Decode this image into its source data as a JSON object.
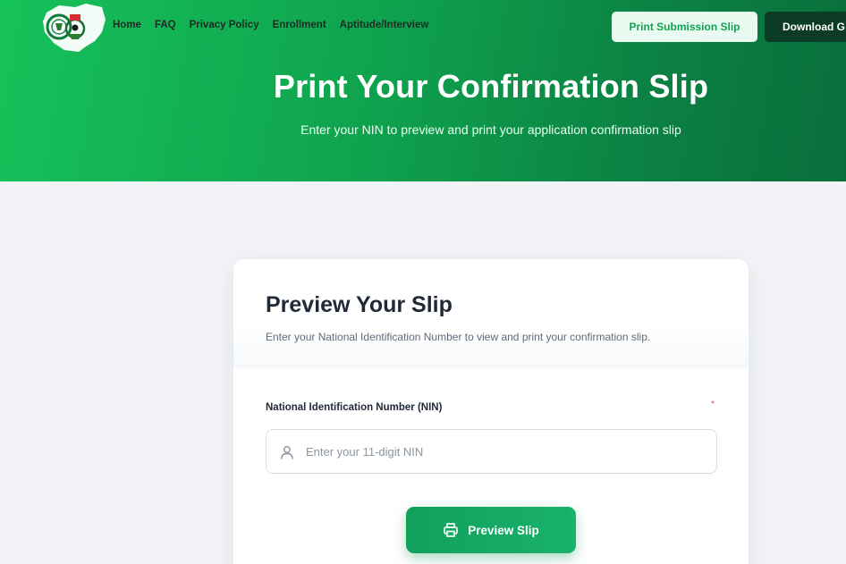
{
  "header": {
    "logo_icon": "nigeria-coat-of-arms-logo-icon",
    "nav": [
      {
        "label": "Home"
      },
      {
        "label": "FAQ"
      },
      {
        "label": "Privacy Policy"
      },
      {
        "label": "Enrollment"
      },
      {
        "label": "Aptitude/Interview"
      }
    ],
    "print_submission_label": "Print Submission Slip",
    "download_label": "Download G"
  },
  "hero": {
    "title": "Print Your Confirmation Slip",
    "subtitle": "Enter your NIN to preview and print your application confirmation slip"
  },
  "card": {
    "title": "Preview Your Slip",
    "description": "Enter your National Identification Number to view and print your confirmation slip.",
    "field_label": "National Identification Number (NIN)",
    "required_mark": "*",
    "input_icon": "user-icon",
    "input_placeholder": "Enter your 11-digit NIN",
    "input_value": "",
    "button_icon": "printer-icon",
    "button_label": "Preview Slip"
  },
  "colors": {
    "hero_start": "#16c25a",
    "hero_end": "#0a6e3b",
    "accent_green": "#12a05b",
    "dark_button": "#0c3b26",
    "page_background": "#f1f3f6"
  }
}
